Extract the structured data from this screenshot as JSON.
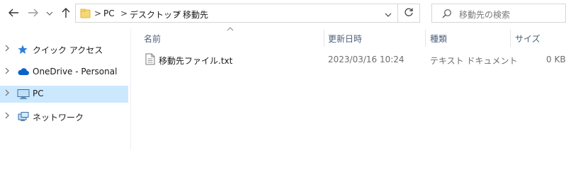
{
  "toolbar": {
    "back_icon": "arrow-left-icon",
    "forward_icon": "arrow-right-icon",
    "recent_icon": "chevron-down-icon",
    "up_icon": "arrow-up-icon"
  },
  "address": {
    "crumbs": [
      "PC",
      "デスクトップ",
      "移動先"
    ],
    "separator": ">"
  },
  "search": {
    "placeholder": "移動先の検索"
  },
  "sidebar": {
    "items": [
      {
        "label": "クイック アクセス",
        "icon": "star-icon",
        "selected": false
      },
      {
        "label": "OneDrive - Personal",
        "icon": "cloud-icon",
        "selected": false
      },
      {
        "label": "PC",
        "icon": "monitor-icon",
        "selected": true
      },
      {
        "label": "ネットワーク",
        "icon": "network-icon",
        "selected": false
      }
    ]
  },
  "list": {
    "columns": {
      "name": "名前",
      "modified": "更新日時",
      "type": "種類",
      "size": "サイズ"
    },
    "files": [
      {
        "name": "移動先ファイル.txt",
        "modified": "2023/03/16 10:24",
        "type": "テキスト ドキュメント",
        "size": "0 KB"
      }
    ]
  },
  "colors": {
    "selection": "#cce8ff",
    "accent": "#0078d4",
    "folder": "#f5c542"
  }
}
